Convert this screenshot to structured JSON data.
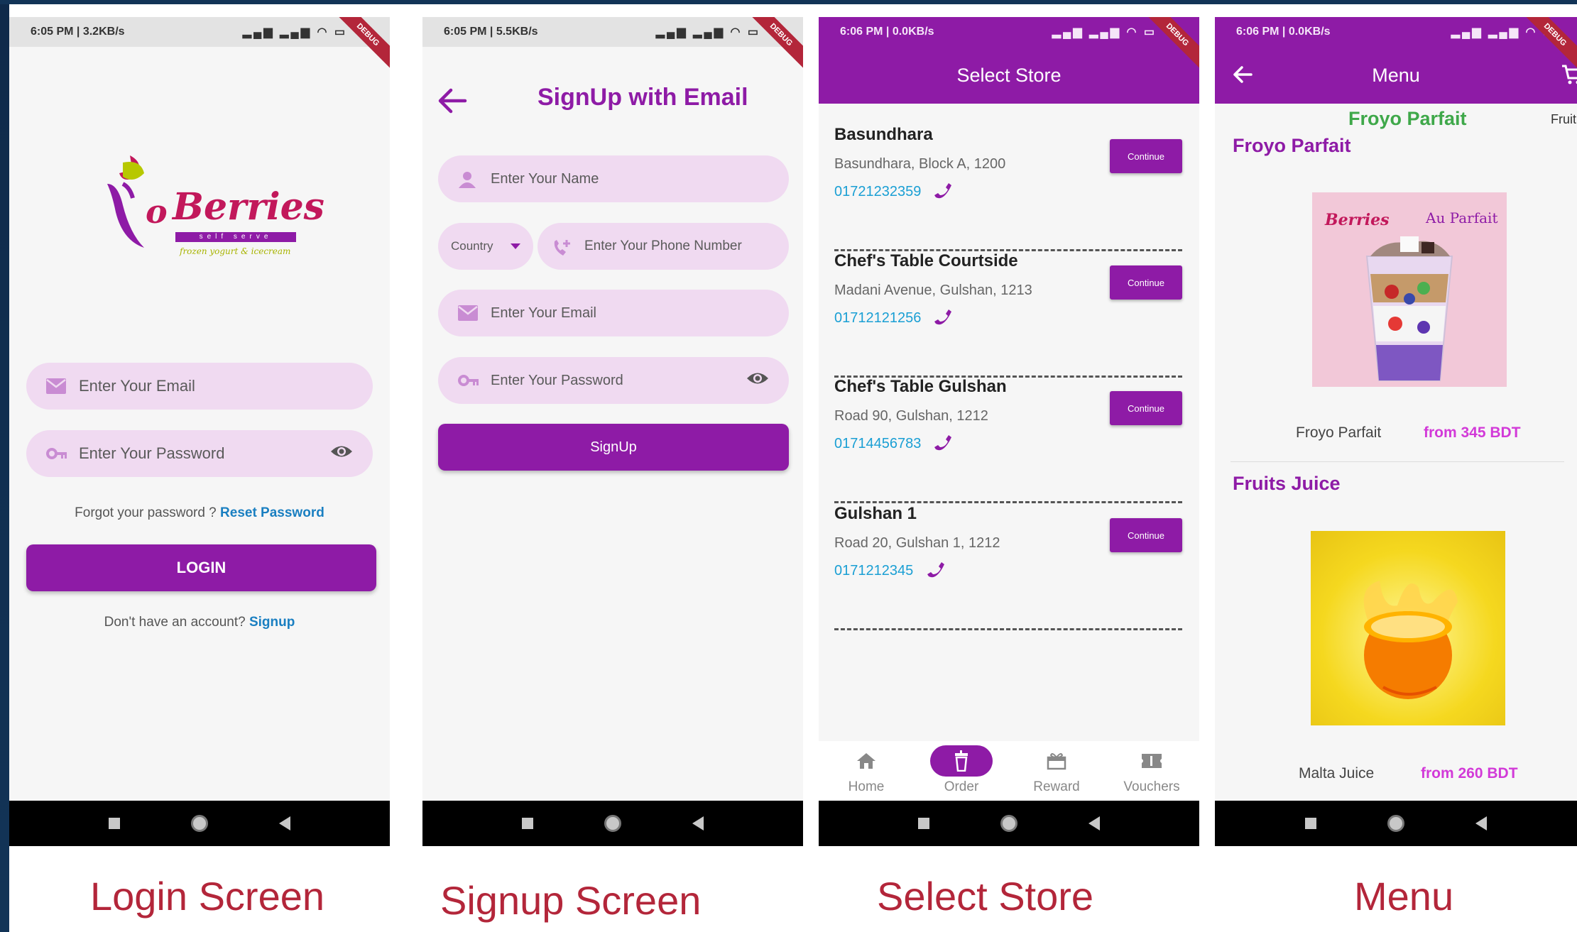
{
  "login": {
    "status_time": "6:05 PM | 3.2KB/s",
    "debug_badge": "DEBUG",
    "logo": {
      "brand": "Berries",
      "prefix": "o",
      "band": "self serve",
      "tagline": "frozen yogurt & icecream"
    },
    "email_placeholder": "Enter Your Email",
    "password_placeholder": "Enter Your Password",
    "forgot_text": "Forgot your password ?",
    "reset_link": "Reset Password",
    "login_button": "LOGIN",
    "no_account_text": "Don't have an account?",
    "signup_link": "Signup",
    "caption": "Login Screen"
  },
  "signup": {
    "status_time": "6:05 PM | 5.5KB/s",
    "debug_badge": "DEBUG",
    "title": "SignUp with Email",
    "name_placeholder": "Enter Your Name",
    "country_label": "Country",
    "phone_placeholder": "Enter Your Phone Number",
    "email_placeholder": "Enter Your Email",
    "password_placeholder": "Enter Your Password",
    "signup_button": "SignUp",
    "caption": "Signup Screen"
  },
  "store": {
    "status_time": "6:06 PM | 0.0KB/s",
    "debug_badge": "DEBUG",
    "title": "Select Store",
    "stores": [
      {
        "name": "Basundhara",
        "address": "Basundhara, Block A, 1200",
        "phone": "01721232359",
        "action": "Continue"
      },
      {
        "name": "Chef's Table Courtside",
        "address": "Madani Avenue, Gulshan, 1213",
        "phone": "01712121256",
        "action": "Continue"
      },
      {
        "name": "Chef's Table Gulshan",
        "address": "Road 90, Gulshan, 1212",
        "phone": "01714456783",
        "action": "Continue"
      },
      {
        "name": "Gulshan 1",
        "address": "Road 20, Gulshan 1, 1212",
        "phone": "0171212345",
        "action": "Continue"
      }
    ],
    "nav": [
      "Home",
      "Order",
      "Reward",
      "Vouchers"
    ],
    "caption": "Select Store"
  },
  "menu": {
    "status_time": "6:06 PM | 0.0KB/s",
    "debug_badge": "DEBUG",
    "title": "Menu",
    "tabs": [
      "Froyo Parfait",
      "Fruit"
    ],
    "sections": [
      {
        "title": "Froyo Parfait",
        "product": "Froyo Parfait",
        "price": "from 345 BDT",
        "image_brand": "Berries",
        "image_label": "Au Parfait"
      },
      {
        "title": "Fruits Juice",
        "product": "Malta Juice",
        "price": "from 260 BDT"
      }
    ],
    "caption": "Menu"
  },
  "colors": {
    "primary": "#8e1ba6",
    "field_bg": "#f0daf1",
    "link": "#1a7fc1",
    "phone": "#1a9fd4",
    "price": "#d23ad8",
    "caption": "#b3263a"
  }
}
